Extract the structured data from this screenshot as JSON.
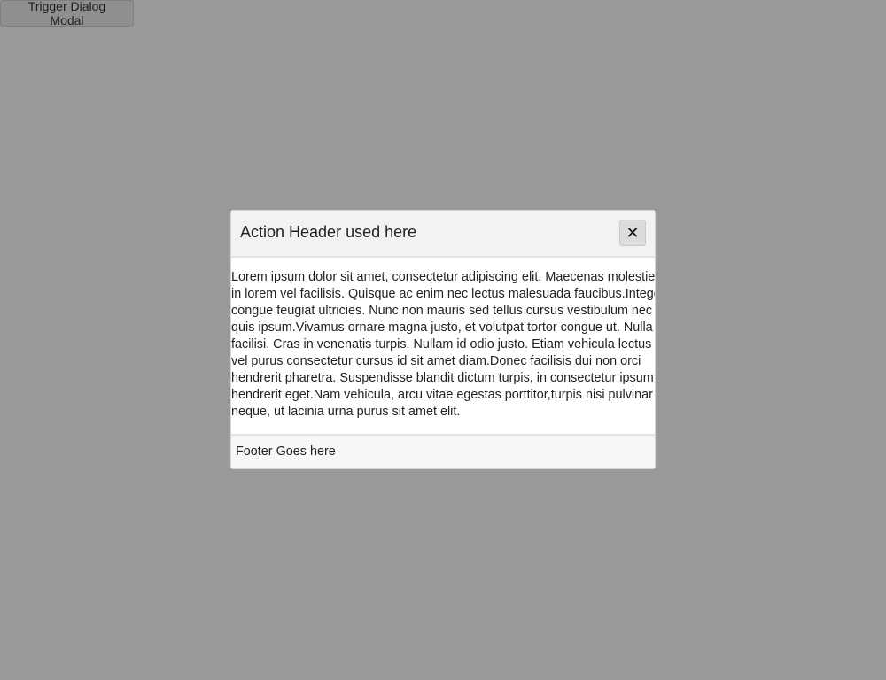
{
  "trigger": {
    "label": "Trigger Dialog Modal"
  },
  "modal": {
    "title": "Action Header used here",
    "close_icon": "close-x-icon",
    "close_glyph": "✕",
    "body_lines": [
      "Lorem ipsum dolor sit amet, consectetur adipiscing elit. Maecenas molestie",
      "in lorem vel facilisis. Quisque ac enim nec lectus malesuada faucibus.Integer",
      "congue feugiat ultricies. Nunc non mauris sed tellus cursus vestibulum nec",
      "quis ipsum.Vivamus ornare magna justo, et volutpat tortor congue ut. Nulla",
      "facilisi. Cras in venenatis turpis. Nullam id odio justo. Etiam vehicula lectus",
      "vel purus consectetur cursus id sit amet diam.Donec facilisis dui non orci",
      "hendrerit pharetra. Suspendisse blandit dictum turpis, in consectetur ipsum",
      "hendrerit eget.Nam vehicula, arcu vitae egestas porttitor,turpis nisi pulvinar",
      "neque, ut lacinia urna purus sit amet elit."
    ],
    "footer": "Footer Goes here"
  }
}
